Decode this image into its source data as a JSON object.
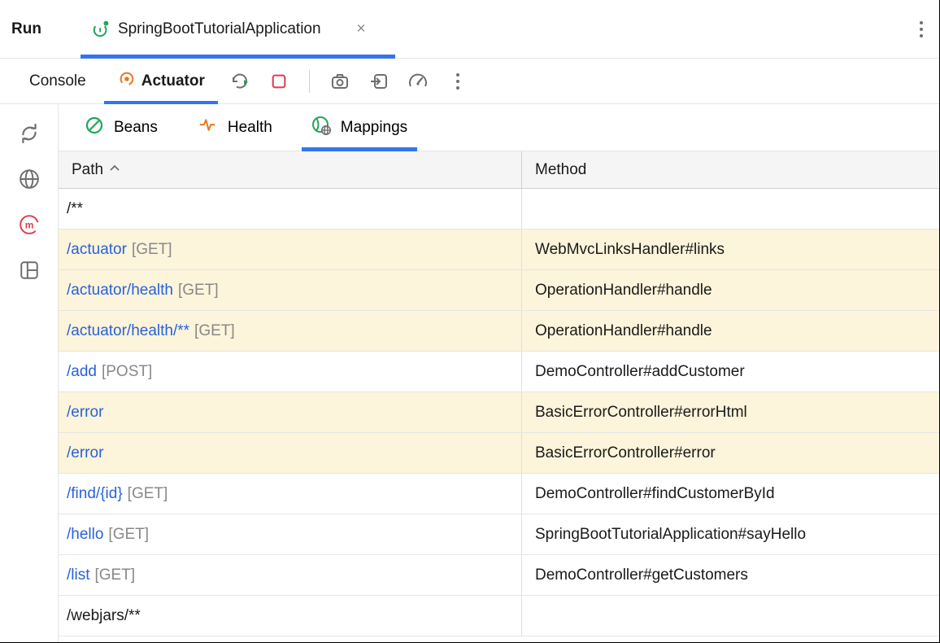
{
  "topBar": {
    "runLabel": "Run",
    "configName": "SpringBootTutorialApplication"
  },
  "subBar": {
    "consoleTab": "Console",
    "actuatorTab": "Actuator"
  },
  "innerTabs": {
    "beans": "Beans",
    "health": "Health",
    "mappings": "Mappings"
  },
  "tableHeaders": {
    "path": "Path",
    "method": "Method"
  },
  "rows": [
    {
      "path": "/**",
      "httpMethod": "",
      "handler": "",
      "isLink": false,
      "highlight": false
    },
    {
      "path": "/actuator",
      "httpMethod": "[GET]",
      "handler": "WebMvcLinksHandler#links",
      "isLink": true,
      "highlight": true
    },
    {
      "path": "/actuator/health",
      "httpMethod": "[GET]",
      "handler": "OperationHandler#handle",
      "isLink": true,
      "highlight": true
    },
    {
      "path": "/actuator/health/**",
      "httpMethod": "[GET]",
      "handler": "OperationHandler#handle",
      "isLink": true,
      "highlight": true
    },
    {
      "path": "/add",
      "httpMethod": "[POST]",
      "handler": "DemoController#addCustomer",
      "isLink": true,
      "highlight": false
    },
    {
      "path": "/error",
      "httpMethod": "",
      "handler": "BasicErrorController#errorHtml",
      "isLink": true,
      "highlight": true
    },
    {
      "path": "/error",
      "httpMethod": "",
      "handler": "BasicErrorController#error",
      "isLink": true,
      "highlight": true
    },
    {
      "path": "/find/{id}",
      "httpMethod": "[GET]",
      "handler": "DemoController#findCustomerById",
      "isLink": true,
      "highlight": false
    },
    {
      "path": "/hello",
      "httpMethod": "[GET]",
      "handler": "SpringBootTutorialApplication#sayHello",
      "isLink": true,
      "highlight": false
    },
    {
      "path": "/list",
      "httpMethod": "[GET]",
      "handler": "DemoController#getCustomers",
      "isLink": true,
      "highlight": false
    },
    {
      "path": "/webjars/**",
      "httpMethod": "",
      "handler": "",
      "isLink": false,
      "highlight": false
    }
  ]
}
